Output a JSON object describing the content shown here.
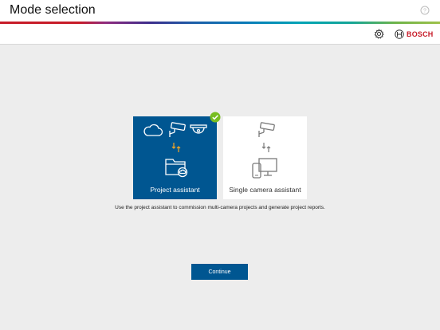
{
  "header": {
    "title": "Mode selection",
    "help_icon": "help-icon"
  },
  "toolbar": {
    "settings_icon": "gear-icon",
    "brand_name": "BOSCH",
    "brand_color": "#c71c29"
  },
  "modes": [
    {
      "label": "Project assistant",
      "selected": true,
      "icons": [
        "cloud-icon",
        "camera-icon",
        "dome-camera-icon",
        "arrows-icon",
        "folder-icon"
      ]
    },
    {
      "label": "Single camera assistant",
      "selected": false,
      "icons": [
        "camera-icon",
        "arrows-icon",
        "tablet-icon",
        "monitor-icon"
      ]
    }
  ],
  "description": "Use the project assistant to commission multi-camera projects and generate project reports.",
  "continue_button": {
    "label": "Continue"
  },
  "colors": {
    "accent": "#005691",
    "check": "#78be20",
    "arrow_orange": "#f5a623",
    "background": "#ededed"
  }
}
